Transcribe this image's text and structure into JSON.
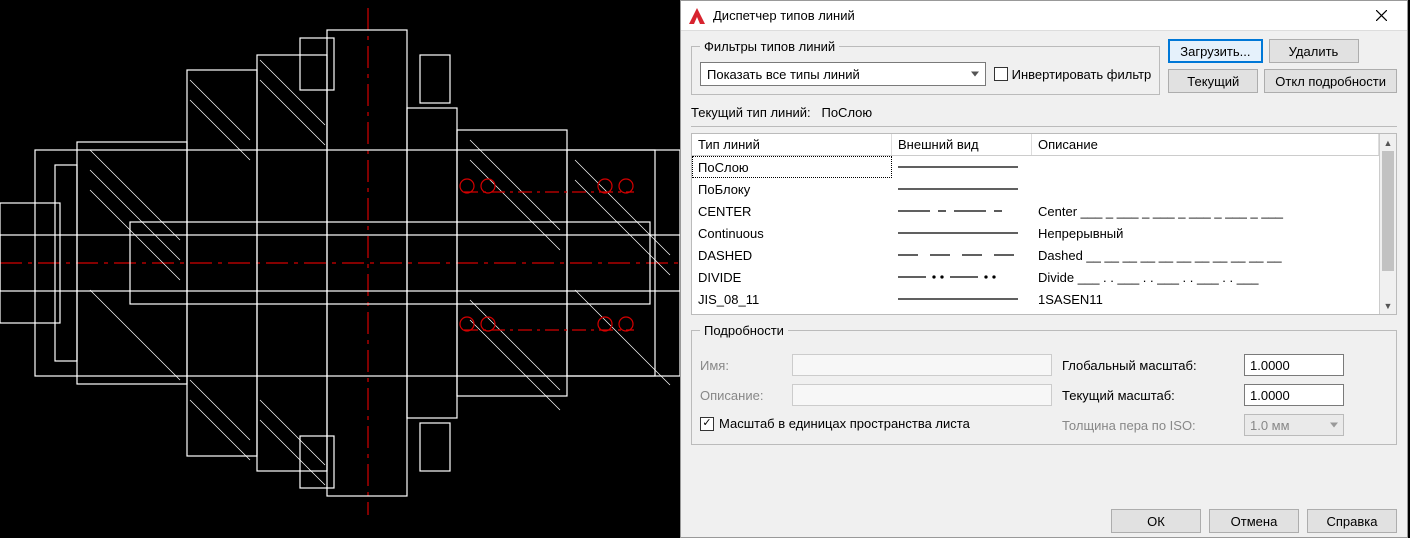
{
  "dialog": {
    "title": "Диспетчер типов линий",
    "filter_group_label": "Фильтры типов линий",
    "filter_value": "Показать все типы линий",
    "invert_label": "Инвертировать фильтр",
    "load_btn": "Загрузить...",
    "delete_btn": "Удалить",
    "current_btn": "Текущий",
    "details_off_btn": "Откл подробности",
    "current_prefix": "Текущий тип линий:",
    "current_value": "ПоСлою",
    "columns": {
      "c1": "Тип линий",
      "c2": "Внешний вид",
      "c3": "Описание"
    },
    "rows": [
      {
        "name": "ПоСлою",
        "preview": "solid",
        "desc": ""
      },
      {
        "name": "ПоБлоку",
        "preview": "solid",
        "desc": ""
      },
      {
        "name": "CENTER",
        "preview": "center",
        "desc": "Center ___ _ ___ _ ___ _ ___ _ ___ _ ___"
      },
      {
        "name": "Continuous",
        "preview": "solid",
        "desc": "Непрерывный"
      },
      {
        "name": "DASHED",
        "preview": "dashed",
        "desc": "Dashed __ __ __ __ __ __ __ __ __ __ __"
      },
      {
        "name": "DIVIDE",
        "preview": "divide",
        "desc": "Divide ___ . . ___ . . ___ . . ___ . . ___"
      },
      {
        "name": "JIS_08_11",
        "preview": "solid",
        "desc": "1SASEN11"
      }
    ],
    "details": {
      "group_label": "Подробности",
      "name_label": "Имя:",
      "desc_label": "Описание:",
      "paperspace_label": "Масштаб в единицах пространства листа",
      "paperspace_checked": true,
      "global_scale_label": "Глобальный масштаб:",
      "global_scale_value": "1.0000",
      "current_scale_label": "Текущий масштаб:",
      "current_scale_value": "1.0000",
      "pen_label": "Толщина пера по ISO:",
      "pen_value": "1.0 мм"
    },
    "ok": "ОК",
    "cancel": "Отмена",
    "help": "Справка"
  }
}
